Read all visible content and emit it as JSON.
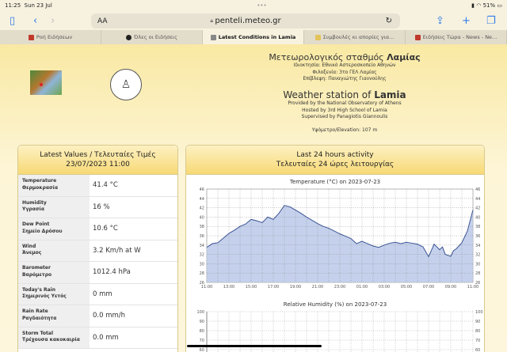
{
  "status": {
    "time": "11:25",
    "date": "Sun 23 Jul",
    "dots": "•••",
    "battery": "51%"
  },
  "toolbar": {
    "text_size": "AA",
    "url": "penteli.meteo.gr"
  },
  "tabs": [
    {
      "label": "Ροή Ειδήσεων",
      "color": "#c0392b"
    },
    {
      "label": "Όλες οι Ειδήσεις",
      "color": "#222"
    },
    {
      "label": "Latest Conditions in Lamia",
      "color": "#666"
    },
    {
      "label": "Συμβουλές κι απορίες για...",
      "color": "#e3c35a"
    },
    {
      "label": "Ειδήσεις Τώρα - News - Ne...",
      "color": "#c0392b"
    }
  ],
  "header": {
    "gr_title": "Μετεωρολογικός σταθμός ",
    "gr_city": "Λαμίας",
    "gr_owner": "Ιδιοκτησία: Εθνικό Αστεροσκοπείο Αθηνών",
    "gr_host": "Φιλοξενία: 3το ΓΕΛ Λαμίας",
    "gr_sup": "Επίβλεψη: Παναγιώτης Γιαννούλης",
    "en_title": "Weather station of ",
    "en_city": "Lamia",
    "en_owner": "Provided by the National Observatory of Athens",
    "en_host": "Hosted by 3rd High School of Lamia",
    "en_sup": "Supervised by Panagiotis Giannoulis",
    "elevation": "Υψόμετρο/Elevation: 107 m"
  },
  "latest": {
    "title": "Latest Values / Τελευταίες Τιμές",
    "datetime": "23/07/2023 11:00",
    "rows": [
      {
        "en": "Temperature",
        "gr": "Θερμοκρασία",
        "value": "41.4 °C"
      },
      {
        "en": "Humidity",
        "gr": "Υγρασία",
        "value": "16 %"
      },
      {
        "en": "Dew Point",
        "gr": "Σημείο Δρόσου",
        "value": "10.6 °C"
      },
      {
        "en": "Wind",
        "gr": "Άνεμος",
        "value": "3.2 Km/h at W"
      },
      {
        "en": "Barometer",
        "gr": "Βαρόμετρο",
        "value": "1012.4 hPa"
      },
      {
        "en": "Today's Rain",
        "gr": "Σημερινός Υετός",
        "value": "0 mm"
      },
      {
        "en": "Rain Rate",
        "gr": "Ραγδαιότητα",
        "value": "0.0 mm/h"
      },
      {
        "en": "Storm Total",
        "gr": "Τρέχουσα κακοκαιρία",
        "value": "0.0 mm"
      }
    ]
  },
  "activity": {
    "title": "Last 24 hours activity",
    "title_gr": "Τελευταίες 24 ώρες λειτουργίας"
  },
  "chart_data": [
    {
      "type": "area",
      "title": "Temperature (°C) on 2023-07-23",
      "ylim": [
        26,
        46
      ],
      "yticks": [
        26,
        28,
        30,
        32,
        34,
        36,
        38,
        40,
        42,
        44,
        46
      ],
      "xticks": [
        "11:00",
        "13:00",
        "15:00",
        "17:00",
        "19:00",
        "21:00",
        "23:00",
        "01:00",
        "03:00",
        "05:00",
        "07:00",
        "09:00",
        "11:00"
      ],
      "xlim": [
        0,
        24
      ],
      "grid": true,
      "fill": "#c5d1ec",
      "line": "#3b5493",
      "x": [
        0,
        0.5,
        1,
        1.5,
        2,
        2.5,
        3,
        3.5,
        4,
        4.5,
        5,
        5.5,
        6,
        6.5,
        7,
        7.5,
        8,
        8.5,
        9,
        9.5,
        10,
        10.5,
        11,
        11.5,
        12,
        12.5,
        13,
        13.5,
        14,
        14.5,
        15,
        15.5,
        16,
        16.5,
        17,
        17.5,
        18,
        18.5,
        19,
        19.5,
        20,
        20.5,
        21,
        21.25,
        21.5,
        22,
        22.25,
        22.5,
        23,
        23.5,
        24
      ],
      "y": [
        33.5,
        34.3,
        34.5,
        35.5,
        36.5,
        37.2,
        38,
        38.5,
        39.5,
        39.2,
        38.8,
        40,
        39.5,
        40.8,
        42.5,
        42.2,
        41.5,
        40.8,
        40,
        39.3,
        38.6,
        38,
        37.6,
        37,
        36.4,
        35.9,
        35.4,
        34.3,
        34.8,
        34.3,
        33.8,
        33.5,
        34,
        34.4,
        34.6,
        34.3,
        34.6,
        34.4,
        34.2,
        33.6,
        31.5,
        34.2,
        33,
        33.6,
        32,
        31.6,
        32.8,
        33.2,
        34.5,
        37,
        41.5
      ]
    },
    {
      "type": "area",
      "title": "Relative Humidity (%) on 2023-07-23",
      "yticks": [
        60,
        70,
        80,
        90,
        100
      ],
      "ylim": [
        0,
        100
      ],
      "grid": true
    }
  ]
}
